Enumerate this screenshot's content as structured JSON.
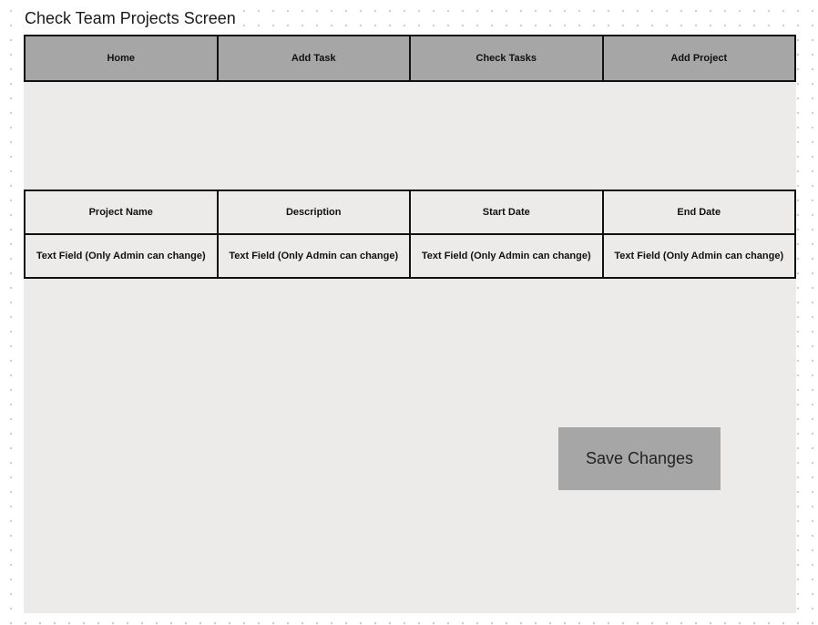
{
  "page": {
    "title": "Check Team Projects Screen"
  },
  "nav": {
    "items": [
      {
        "label": "Home"
      },
      {
        "label": "Add Task"
      },
      {
        "label": "Check Tasks"
      },
      {
        "label": "Add Project"
      }
    ]
  },
  "project_table": {
    "headers": [
      "Project Name",
      "Description",
      "Start Date",
      "End Date"
    ],
    "rows": [
      [
        "Text Field (Only Admin can change)",
        "Text Field (Only Admin can change)",
        "Text Field (Only Admin can change)",
        "Text Field (Only Admin can change)"
      ]
    ]
  },
  "actions": {
    "save_label": "Save Changes"
  },
  "colors": {
    "nav_background": "#a6a6a6",
    "canvas_background": "#ecebea",
    "border": "#111111",
    "button_background": "#a6a6a6"
  }
}
